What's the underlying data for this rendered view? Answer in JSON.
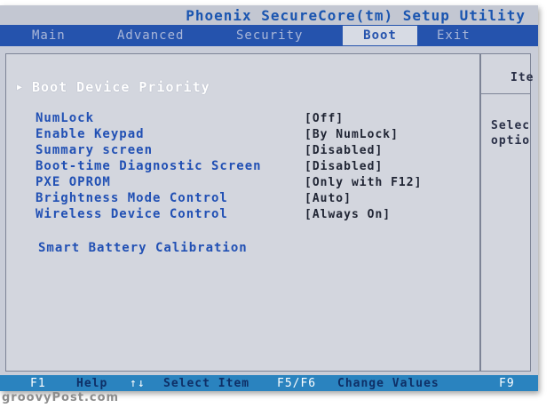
{
  "title": "Phoenix SecureCore(tm) Setup Utility",
  "tabs": [
    {
      "label": "Main",
      "active": false
    },
    {
      "label": "Advanced",
      "active": false
    },
    {
      "label": "Security",
      "active": false
    },
    {
      "label": "Boot",
      "active": true
    },
    {
      "label": "Exit",
      "active": false
    }
  ],
  "submenu": {
    "label": "Boot Device Priority"
  },
  "settings": [
    {
      "label": "NumLock",
      "value": "[Off]"
    },
    {
      "label": "Enable Keypad",
      "value": "[By NumLock]"
    },
    {
      "label": "Summary screen",
      "value": "[Disabled]"
    },
    {
      "label": "Boot-time Diagnostic Screen",
      "value": "[Disabled]"
    },
    {
      "label": "PXE OPROM",
      "value": "[Only with F12]"
    },
    {
      "label": "Brightness Mode Control",
      "value": "[Auto]"
    },
    {
      "label": "Wireless Device Control",
      "value": "[Always On]"
    }
  ],
  "smart_battery": "Smart Battery Calibration",
  "help_panel": {
    "header": "Ite",
    "line1": "Selec",
    "line2": "optio"
  },
  "footer": {
    "f1_key": "F1",
    "f1_desc": "Help",
    "arrows_key": "↑↓",
    "arrows_desc": "Select Item",
    "f5f6_key": "F5/F6",
    "f5f6_desc": "Change Values",
    "f9_key": "F9"
  },
  "watermark": "groovyPost.com",
  "colors": {
    "tab_bar": "#2553ad",
    "footer_bar": "#2a83bf",
    "item_text": "#2150b4",
    "background": "#d3d6de"
  }
}
